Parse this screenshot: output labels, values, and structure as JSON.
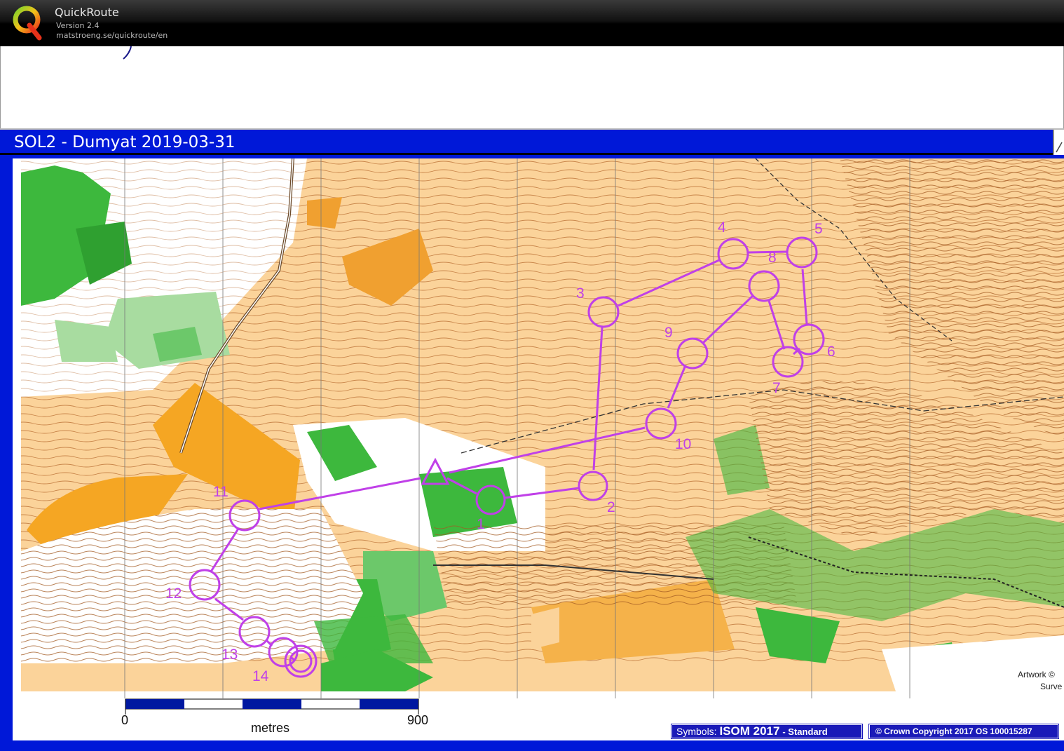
{
  "app": {
    "name": "QuickRoute",
    "version": "Version 2.4",
    "url": "matstroeng.se/quickroute/en"
  },
  "map": {
    "title": "SOL2 - Dumyat 2019-03-31",
    "scale": {
      "start": "0",
      "unit": "metres",
      "end": "900"
    },
    "symbols_label": "Symbols:",
    "symbols_standard": "ISOM 2017",
    "symbols_variant": "- Standard",
    "copyright": "© Crown Copyright 2017 OS 100015287",
    "artwork": "Artwork ©",
    "survey": "Surve"
  },
  "course": {
    "controls": [
      "1",
      "2",
      "3",
      "4",
      "5",
      "6",
      "7",
      "8",
      "9",
      "10",
      "11",
      "12",
      "13",
      "14"
    ],
    "color": "#c040e8"
  },
  "colors": {
    "header_blue": "#0018d8",
    "open_land": "#fbd39a",
    "rough_open": "#f5a623",
    "forest_green": "#3db83d",
    "light_green": "#a8dca0",
    "contour_brown": "#b4652a"
  }
}
